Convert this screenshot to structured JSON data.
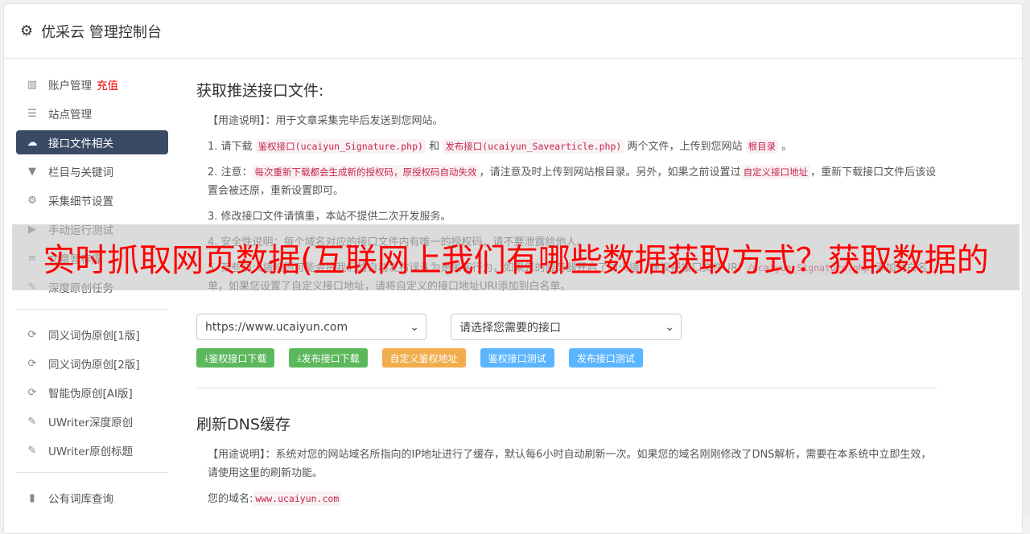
{
  "header": {
    "title": "优采云 管理控制台",
    "icon": "gear-icon"
  },
  "sidebar": {
    "items": [
      {
        "label": "账户管理",
        "badge": "充值",
        "icon": "bar-chart-icon",
        "glyph": "▥"
      },
      {
        "label": "站点管理",
        "icon": "server-icon",
        "glyph": "☰"
      },
      {
        "label": "接口文件相关",
        "icon": "cloud-upload-icon",
        "glyph": "☁",
        "active": true
      },
      {
        "label": "栏目与关键词",
        "icon": "filter-icon",
        "glyph": "▼"
      },
      {
        "label": "采集细节设置",
        "icon": "cogs-icon",
        "glyph": "⚙"
      },
      {
        "label": "手动运行测试",
        "icon": "play-circle-icon",
        "glyph": "▶"
      },
      {
        "label": "文章暂存库",
        "icon": "database-icon",
        "glyph": "≡"
      },
      {
        "label": "深度原创任务",
        "icon": "edit-icon",
        "glyph": "✎"
      },
      {
        "label": "同义词伪原创[1版]",
        "icon": "refresh-icon",
        "glyph": "⟳"
      },
      {
        "label": "同义词伪原创[2版]",
        "icon": "refresh-icon",
        "glyph": "⟳"
      },
      {
        "label": "智能伪原创[AI版]",
        "icon": "refresh-icon",
        "glyph": "⟳"
      },
      {
        "label": "UWriter深度原创",
        "icon": "edit-icon",
        "glyph": "✎"
      },
      {
        "label": "UWriter原创标题",
        "icon": "edit-icon",
        "glyph": "✎"
      },
      {
        "label": "公有词库查询",
        "icon": "book-icon",
        "glyph": "▮"
      }
    ]
  },
  "section1": {
    "title": "获取推送接口文件:",
    "usage": "【用途说明】：用于文章采集完毕后发送到您网站。",
    "p1": {
      "a": "1. 请下载",
      "c1": "鉴权接口(ucaiyun_Signature.php)",
      "b": "和",
      "c2": "发布接口(ucaiyun_Savearticle.php)",
      "d": "两个文件，上传到您网站",
      "c3": "根目录",
      "e": "。"
    },
    "p2": {
      "a": "2. 注意：",
      "c1": "每次重新下载都会生成新的授权码，原授权码自动失效",
      "b": "，请注意及时上传到网站根目录。另外，如果之前设置过",
      "c2": "自定义接口地址",
      "d": "，重新下载接口文件后该设置会被还原，重新设置即可。"
    },
    "p3": "3. 修改接口文件请慎重，本站不提供二次开发服务。",
    "p4": "4. 安全性说明：每个域名对应的接口文件内有唯一的授权码，请不要泄露给他人。",
    "p5": {
      "a": "5. 某些防火墙规则可能会把我们的自动发布误认为是黑客行为，如果您的服务器开启了防火墙，建议把接口文件URI",
      "c1": "/ucaiyun_Signature.php",
      "b": "添加到白名单，如果您设置了自定义接口地址，请将自定义的接口地址URI添加到白名单。"
    },
    "site_select": "https://www.ucaiyun.com",
    "api_select": "请选择您需要的接口",
    "buttons": {
      "download_sign": "鉴权接口下载",
      "download_publish": "发布接口下载",
      "custom_sign": "自定义鉴权地址",
      "test_sign": "鉴权接口测试",
      "test_publish": "发布接口测试"
    }
  },
  "section2": {
    "title": "刷新DNS缓存",
    "usage": "【用途说明】：系统对您的网站域名所指向的IP地址进行了缓存，默认每6小时自动刷新一次。如果您的域名刚刚修改了DNS解析，需要在本系统中立即生效，请使用这里的刷新功能。",
    "domain_label": "您的域名:",
    "domain": "www.ucaiyun.com"
  },
  "overlay": "实时抓取网页数据(互联网上我们有哪些数据获取方式？获取数据的",
  "colors": {
    "active_nav": "#3a4a65",
    "green": "#5cb85c",
    "orange": "#f0ad4e",
    "blue": "#5bb5ff",
    "overlay_text": "#ff0000"
  }
}
